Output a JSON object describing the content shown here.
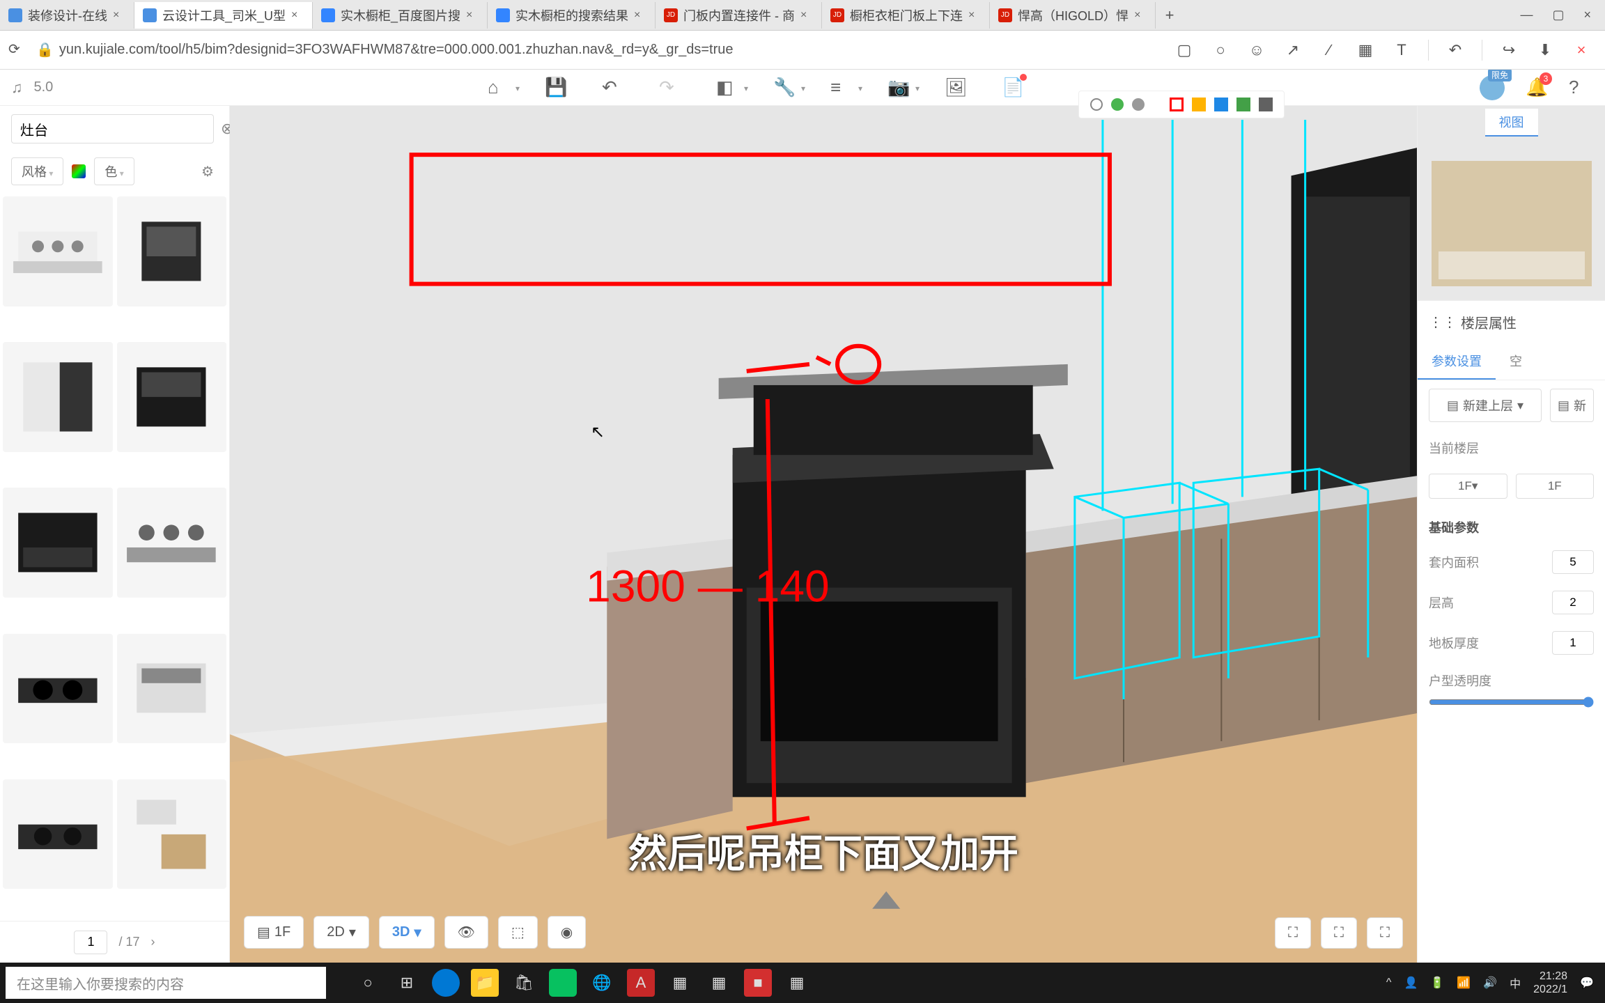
{
  "browser": {
    "tabs": [
      {
        "title": "装修设计-在线",
        "iconColor": "#4a90e2"
      },
      {
        "title": "云设计工具_司米_U型",
        "iconColor": "#4a90e2",
        "active": true
      },
      {
        "title": "实木橱柜_百度图片搜",
        "iconColor": "#3385ff"
      },
      {
        "title": "实木橱柜的搜索结果",
        "iconColor": "#3385ff"
      },
      {
        "title": "门板内置连接件 - 商",
        "iconColor": "#d81e06"
      },
      {
        "title": "橱柜衣柜门板上下连",
        "iconColor": "#d81e06"
      },
      {
        "title": "悍高（HIGOLD）悍",
        "iconColor": "#d81e06"
      }
    ],
    "url": "yun.kujiale.com/tool/h5/bim?designid=3FO3WAFHWM87&tre=000.000.001.zhuzhan.nav&_rd=y&_gr_ds=true"
  },
  "app": {
    "version": "5.0",
    "notif_count": "3",
    "avatar_badge": "限免"
  },
  "sidebar": {
    "search_value": "灶台",
    "filter_style": "风格",
    "filter_color": "色",
    "page_current": "1",
    "page_total": "/ 17"
  },
  "rpanel": {
    "minimap_tab": "视图",
    "section": "楼层属性",
    "tab_param": "参数设置",
    "tab_space": "空",
    "btn_new_upper": "新建上层",
    "btn_new": "新",
    "lbl_current_floor": "当前楼层",
    "floor_from": "1F",
    "floor_to": "1F",
    "base_params": "基础参数",
    "lbl_area": "套内面积",
    "val_area": "5",
    "lbl_height": "层高",
    "val_height": "2",
    "lbl_floor_thick": "地板厚度",
    "val_floor_thick": "1",
    "lbl_transparency": "户型透明度"
  },
  "canvas": {
    "floor_btn": "1F",
    "view_2d": "2D",
    "view_3d": "3D",
    "subtitle": "然后呢吊柜下面又加开",
    "annotation_text": "1300 — 140"
  },
  "taskbar": {
    "search_placeholder": "在这里输入你要搜索的内容",
    "ime": "中",
    "time": "21:28",
    "date": "2022/1"
  }
}
